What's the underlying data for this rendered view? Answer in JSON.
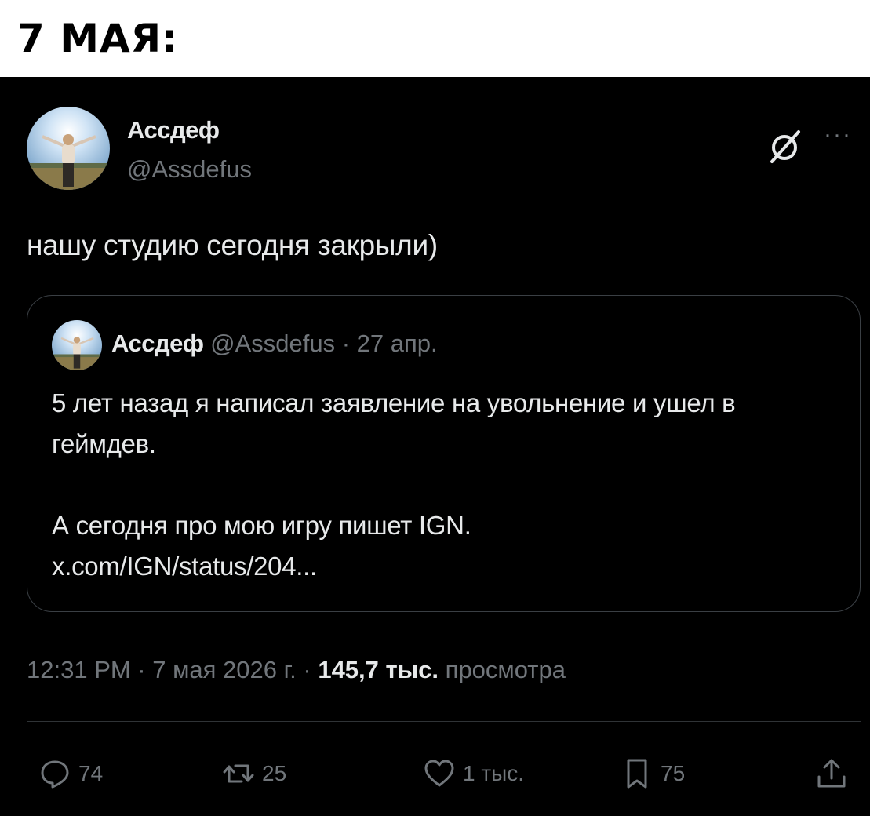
{
  "caption": "7 МАЯ:",
  "tweet": {
    "author_name": "Ассдеф",
    "author_handle": "@Assdefus",
    "text": "нашу студию сегодня закрыли)",
    "quote": {
      "author_name": "Ассдеф",
      "meta": "@Assdefus · 27 апр.",
      "body_line1": "5 лет назад я написал заявление на увольнение и ушел в геймдев.",
      "body_line2": "А сегодня про мою игру пишет IGN.",
      "link": "x.com/IGN/status/204..."
    },
    "timestamp": "12:31 PM · 7 мая 2026 г. ·",
    "views_count": "145,7 тыс.",
    "views_label": "просмотра",
    "actions": {
      "replies": "74",
      "reposts": "25",
      "likes": "1 тыс.",
      "bookmarks": "75"
    }
  },
  "icons": {
    "grok": "grok-icon",
    "more": "more-icon",
    "reply": "reply-icon",
    "repost": "repost-icon",
    "like": "heart-icon",
    "bookmark": "bookmark-icon",
    "share": "share-icon"
  },
  "colors": {
    "background": "#000000",
    "text_primary": "#e7e9ea",
    "text_secondary": "#71767b",
    "border": "#3a3f44"
  }
}
